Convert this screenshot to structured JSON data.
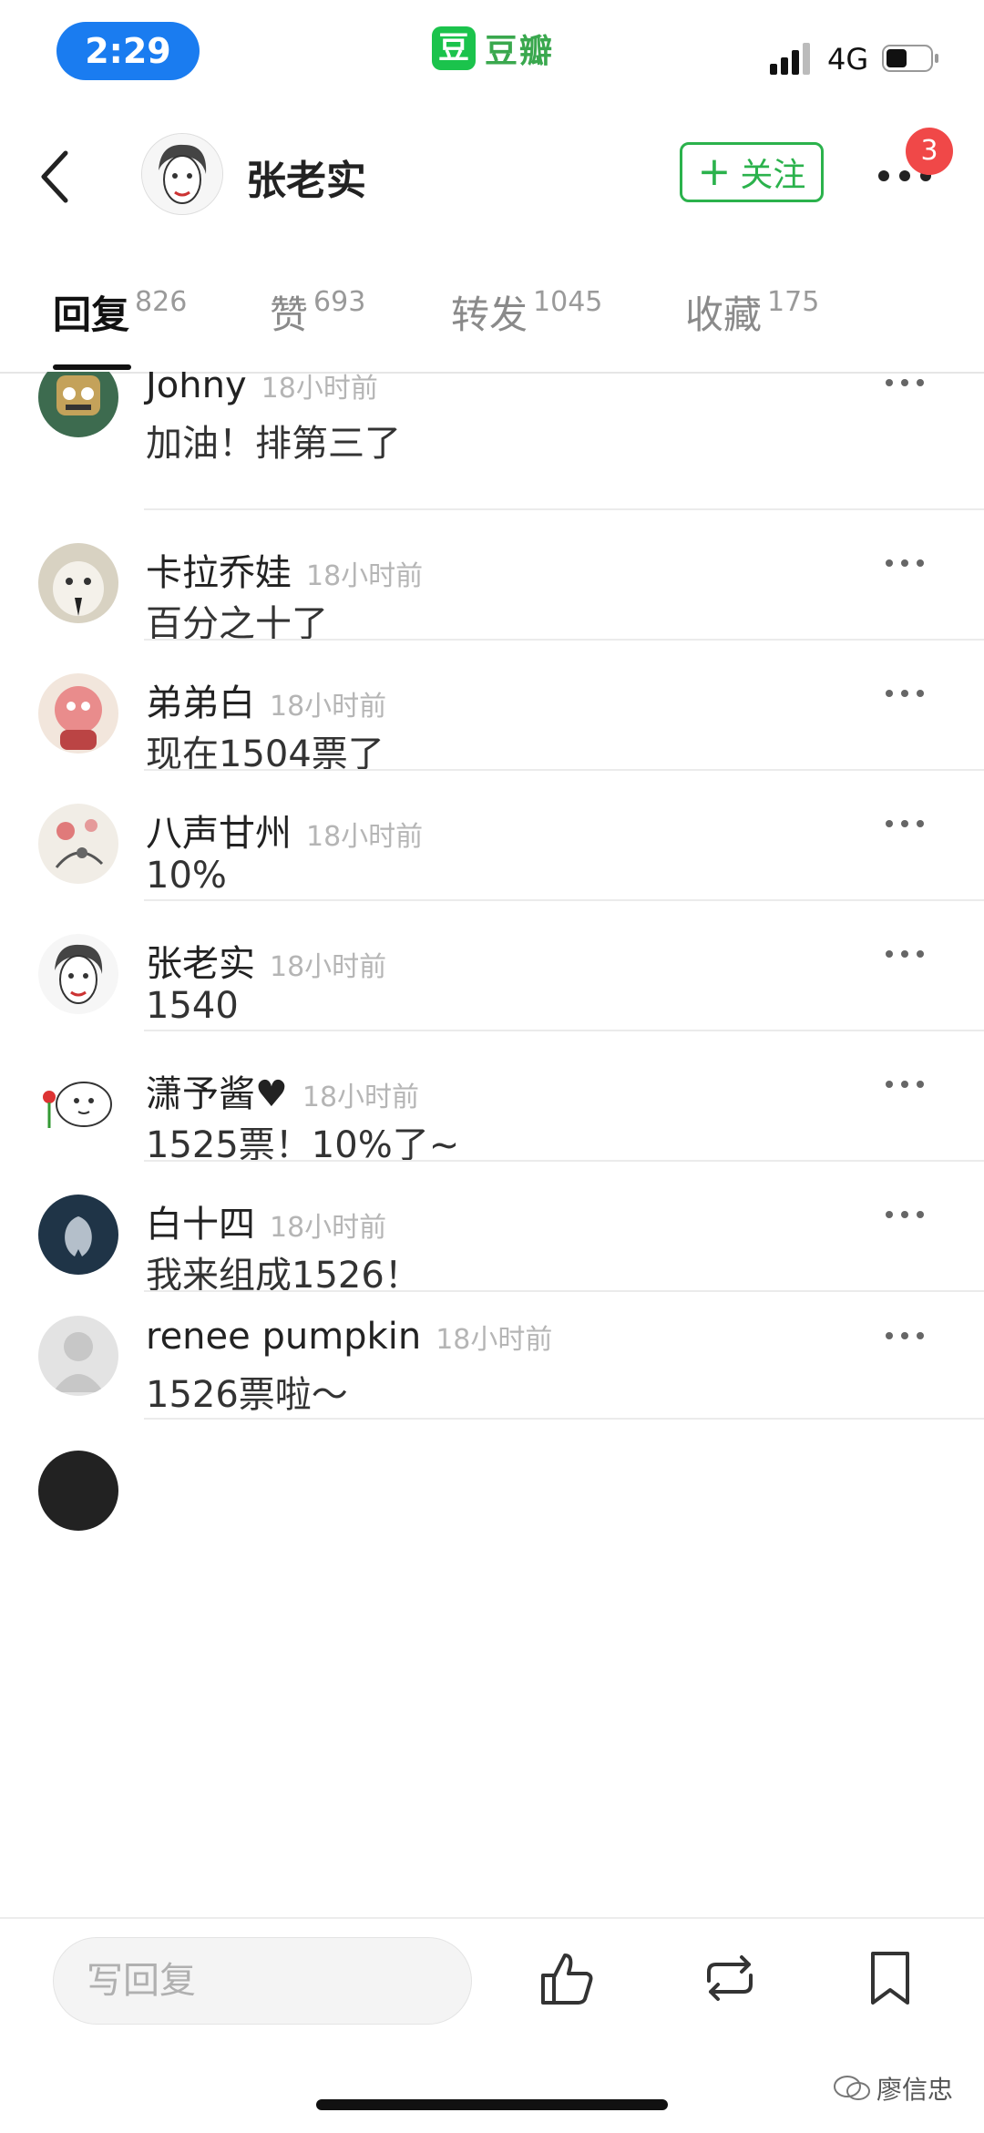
{
  "status_bar": {
    "time": "2:29",
    "app_logo_char": "豆",
    "app_name": "豆瓣",
    "network": "4G"
  },
  "header": {
    "user_name": "张老实",
    "follow_label": "关注",
    "notification_count": "3"
  },
  "tabs": [
    {
      "label": "回复",
      "count": "826",
      "active": true
    },
    {
      "label": "赞",
      "count": "693"
    },
    {
      "label": "转发",
      "count": "1045"
    },
    {
      "label": "收藏",
      "count": "175"
    }
  ],
  "comments": [
    {
      "name": "Johny",
      "time": "18小时前",
      "text": "加油！排第三了"
    },
    {
      "name": "卡拉乔娃",
      "time": "18小时前",
      "text": "百分之十了"
    },
    {
      "name": "弟弟白",
      "time": "18小时前",
      "text": "现在1504票了"
    },
    {
      "name": "八声甘州",
      "time": "18小时前",
      "text": "10%"
    },
    {
      "name": "张老实",
      "time": "18小时前",
      "text": "1540"
    },
    {
      "name": "潇予酱♥",
      "time": "18小时前",
      "text": "1525票！10%了~"
    },
    {
      "name": "白十四",
      "time": "18小时前",
      "text": "我来组成1526！"
    },
    {
      "name": "renee pumpkin",
      "time": "18小时前",
      "text": "1526票啦～"
    }
  ],
  "bottom_bar": {
    "reply_placeholder": "写回复"
  },
  "watermark": "廖信忠",
  "colors": {
    "accent_green": "#2bb24c",
    "badge_red": "#f04848",
    "time_pill_blue": "#1a7cf0"
  }
}
